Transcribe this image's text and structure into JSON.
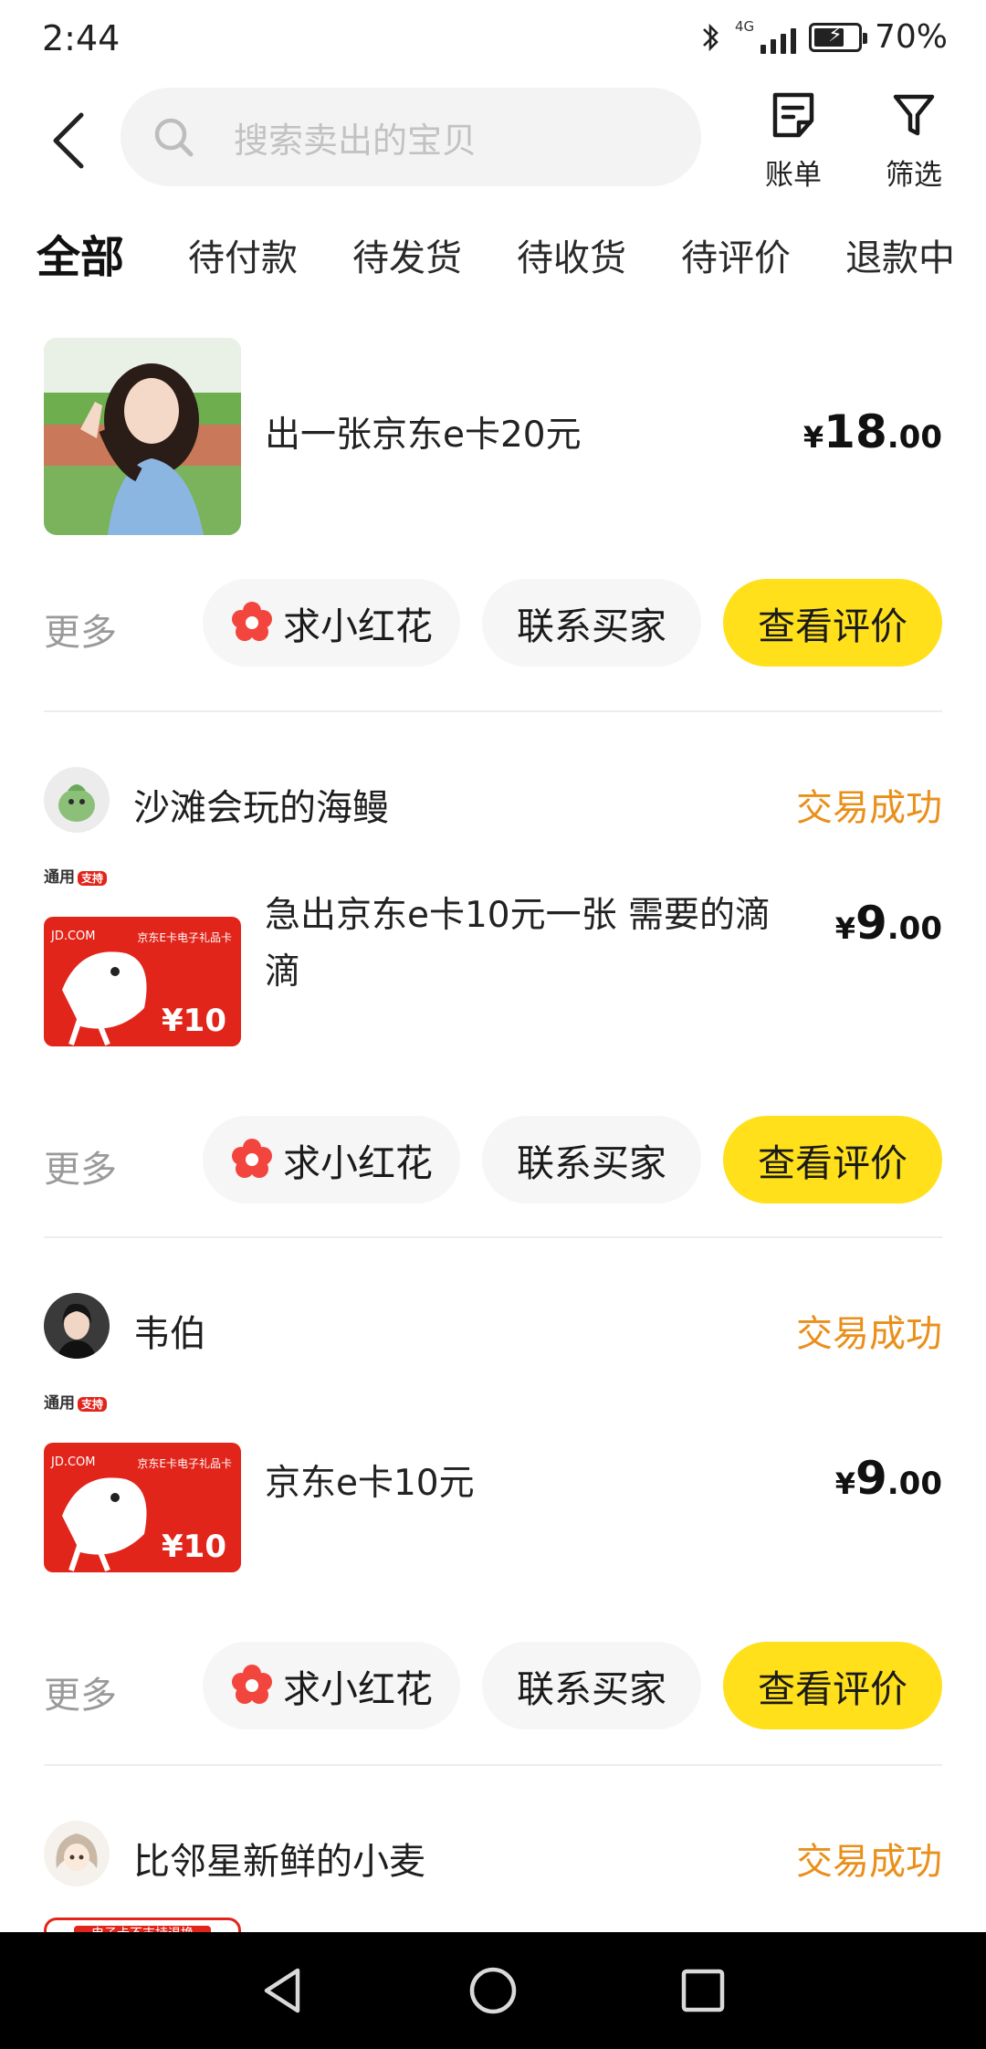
{
  "status_bar": {
    "time": "2:44",
    "network": "4G",
    "battery": "70%",
    "battery_level": 0.7
  },
  "header": {
    "search_placeholder": "搜索卖出的宝贝",
    "bill_label": "账单",
    "filter_label": "筛选"
  },
  "tabs": [
    {
      "label": "全部",
      "active": true
    },
    {
      "label": "待付款"
    },
    {
      "label": "待发货"
    },
    {
      "label": "待收货"
    },
    {
      "label": "待评价"
    },
    {
      "label": "退款中"
    }
  ],
  "orders": [
    {
      "title": "出一张京东e卡20元",
      "price_symbol": "¥",
      "price_int": "18",
      "price_dec": ".00"
    },
    {
      "seller": "沙滩会玩的海鳗",
      "status": "交易成功",
      "title": "急出京东e卡10元一张 需要的滴滴",
      "price_symbol": "¥",
      "price_int": "9",
      "price_dec": ".00",
      "card_tag": "通用",
      "card_tag_badge": "支持",
      "card_brand": "JD.COM",
      "card_type": "京东E卡电子礼品卡",
      "card_value": "¥10"
    },
    {
      "seller": "韦伯",
      "status": "交易成功",
      "title": "京东e卡10元",
      "price_symbol": "¥",
      "price_int": "9",
      "price_dec": ".00",
      "card_tag": "通用",
      "card_tag_badge": "支持",
      "card_brand": "JD.COM",
      "card_type": "京东E卡电子礼品卡",
      "card_value": "¥10"
    },
    {
      "seller": "比邻星新鲜的小麦",
      "status": "交易成功",
      "card_banner": "电子卡不支持退换"
    }
  ],
  "actions": {
    "more": "更多",
    "flower": "求小红花",
    "contact": "联系买家",
    "review": "查看评价"
  },
  "colors": {
    "accent_yellow": "#ffe01b",
    "status_orange": "#ea8f1a",
    "flower_red": "#f2453d",
    "jd_red": "#e1251b"
  }
}
